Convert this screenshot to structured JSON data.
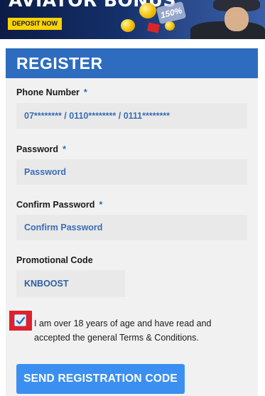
{
  "banner": {
    "title": "AVIATOR BONUS",
    "deposit_label": "DEPOSIT NOW",
    "badge_text": "150%"
  },
  "form": {
    "title": "REGISTER",
    "required_mark": "*",
    "phone": {
      "label": "Phone Number",
      "placeholder": "07******** / 0110******** / 0111********"
    },
    "password": {
      "label": "Password",
      "placeholder": "Password"
    },
    "confirm_password": {
      "label": "Confirm Password",
      "placeholder": "Confirm Password"
    },
    "promo": {
      "label": "Promotional Code",
      "value": "KNBOOST"
    },
    "terms": {
      "checked": true,
      "text": "I am over 18 years of age and have read and accepted the general Terms & Conditions."
    },
    "submit_label": "SEND REGISTRATION CODE"
  },
  "colors": {
    "header_blue": "#2e6cc0",
    "button_blue": "#3b8ff0",
    "checkbox_highlight": "#e0202a",
    "deposit_yellow": "#ffd200"
  }
}
